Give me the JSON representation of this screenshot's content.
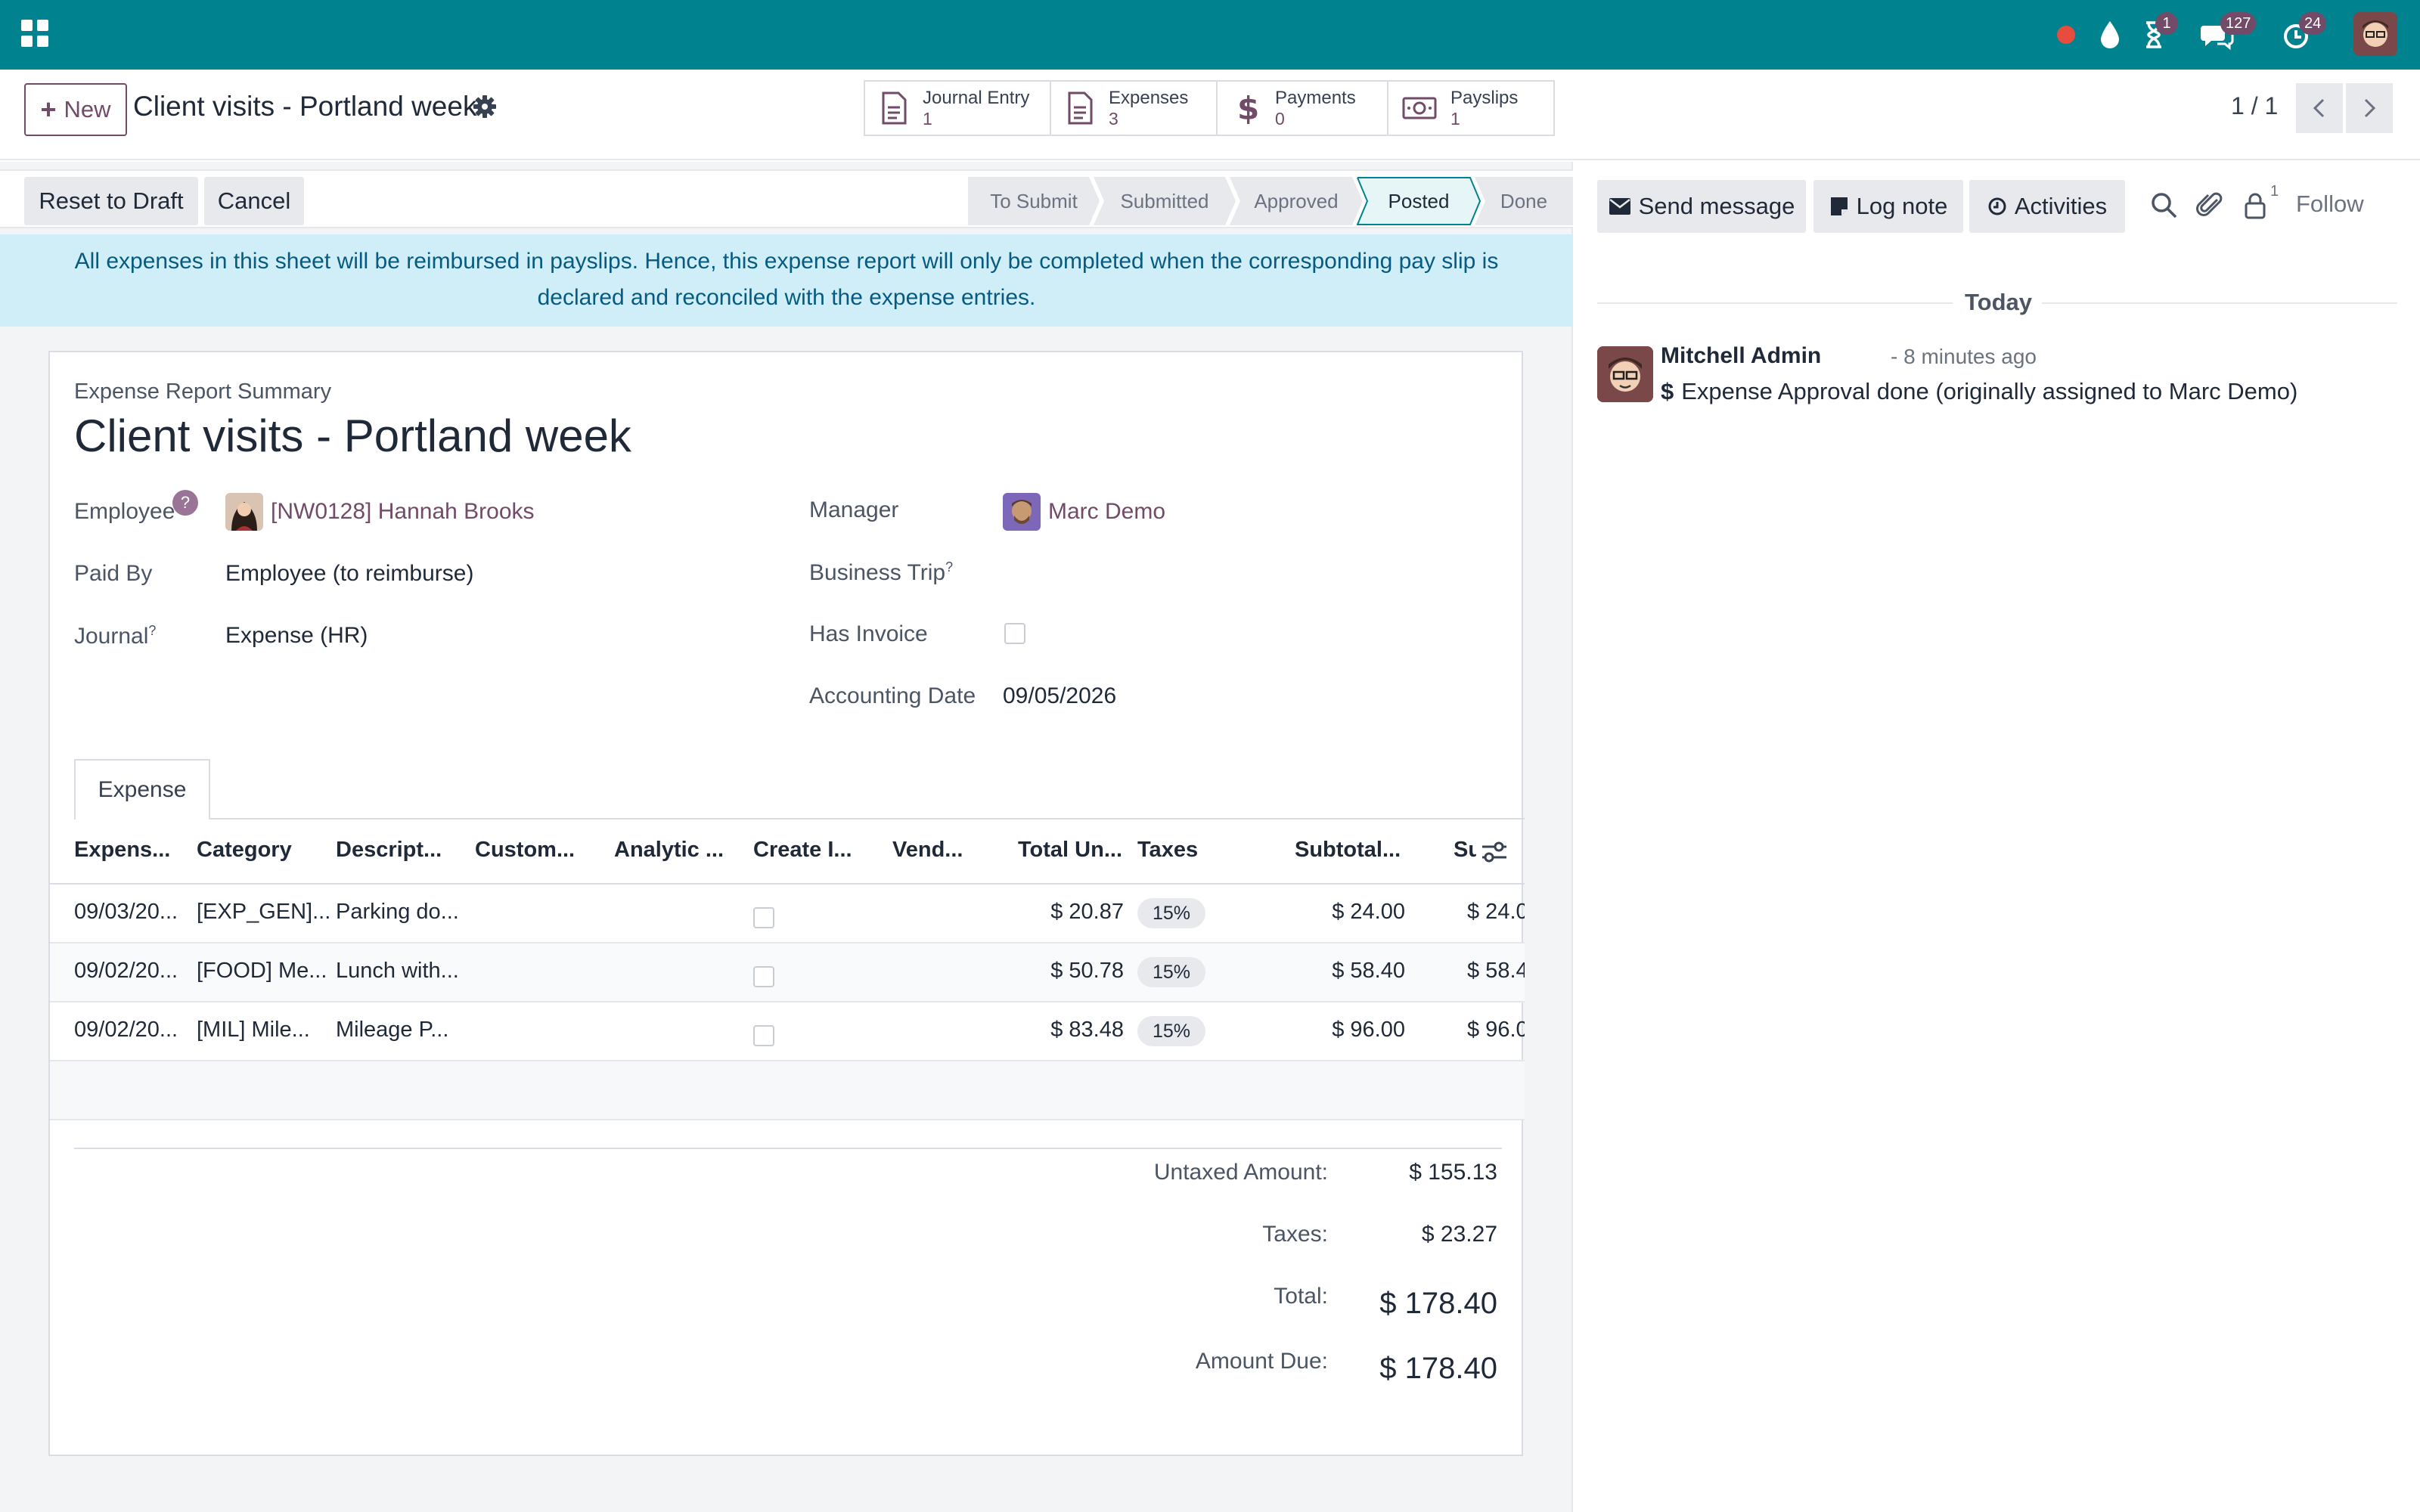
{
  "navbar": {
    "badges": {
      "activities": "1",
      "messages": "127",
      "updates": "24"
    }
  },
  "control": {
    "new_label": "New",
    "title": "Client visits - Portland week",
    "smart_buttons": [
      {
        "label": "Journal Entry",
        "count": "1",
        "icon": "document-icon"
      },
      {
        "label": "Expenses",
        "count": "3",
        "icon": "document-icon"
      },
      {
        "label": "Payments",
        "count": "0",
        "icon": "dollar-icon"
      },
      {
        "label": "Payslips",
        "count": "1",
        "icon": "money-bill-icon"
      }
    ],
    "pager": "1 / 1"
  },
  "statusbar": {
    "reset_label": "Reset to Draft",
    "cancel_label": "Cancel",
    "stages": [
      "To Submit",
      "Submitted",
      "Approved",
      "Posted",
      "Done"
    ],
    "active_stage": "Posted"
  },
  "alert": {
    "line1": "All expenses in this sheet will be reimbursed in payslips. Hence, this expense report will only be completed when the corresponding pay slip is",
    "line2": "declared and reconciled with the expense entries."
  },
  "sheet": {
    "subtitle": "Expense Report Summary",
    "title": "Client visits - Portland week",
    "fields": {
      "employee_label": "Employee",
      "employee_help": "?",
      "employee_value": "[NW0128] Hannah Brooks",
      "paid_by_label": "Paid By",
      "paid_by_value": "Employee (to reimburse)",
      "journal_label": "Journal",
      "journal_value": "Expense (HR)",
      "manager_label": "Manager",
      "manager_value": "Marc Demo",
      "business_trip_label": "Business Trip",
      "has_invoice_label": "Has Invoice",
      "accounting_date_label": "Accounting Date",
      "accounting_date_value": "09/05/2026",
      "help_mark": "?"
    },
    "tab_label": "Expense",
    "table": {
      "headers": [
        "Expens...",
        "Category",
        "Descript...",
        "Custom...",
        "Analytic ...",
        "Create I...",
        "Vend...",
        "Total Un...",
        "Taxes",
        "Subtotal...",
        "Su"
      ],
      "rows": [
        {
          "date": "09/03/20...",
          "category": "[EXP_GEN]...",
          "description": "Parking do...",
          "total": "$ 20.87",
          "tax": "15%",
          "subtotal": "$ 24.00",
          "sub2": "$ 24.0"
        },
        {
          "date": "09/02/20...",
          "category": "[FOOD] Me...",
          "description": "Lunch with...",
          "total": "$ 50.78",
          "tax": "15%",
          "subtotal": "$ 58.40",
          "sub2": "$ 58.4"
        },
        {
          "date": "09/02/20...",
          "category": "[MIL] Mile...",
          "description": "Mileage P...",
          "total": "$ 83.48",
          "tax": "15%",
          "subtotal": "$ 96.00",
          "sub2": "$ 96.0"
        }
      ]
    },
    "totals": {
      "untaxed_label": "Untaxed Amount:",
      "untaxed_value": "$ 155.13",
      "taxes_label": "Taxes:",
      "taxes_value": "$ 23.27",
      "total_label": "Total:",
      "total_value": "$ 178.40",
      "due_label": "Amount Due:",
      "due_value": "$ 178.40"
    }
  },
  "chatter": {
    "send_message": "Send message",
    "log_note": "Log note",
    "activities": "Activities",
    "followers_count": "1",
    "follow": "Follow",
    "today": "Today",
    "message": {
      "author": "Mitchell Admin",
      "time": "- 8 minutes ago",
      "body": "Expense Approval done (originally assigned to Marc Demo)"
    }
  },
  "colors": {
    "navbar": "#01838f",
    "brand": "#714b67",
    "alert_bg": "#cfeef7",
    "active_stage": "#e6f5f6"
  }
}
